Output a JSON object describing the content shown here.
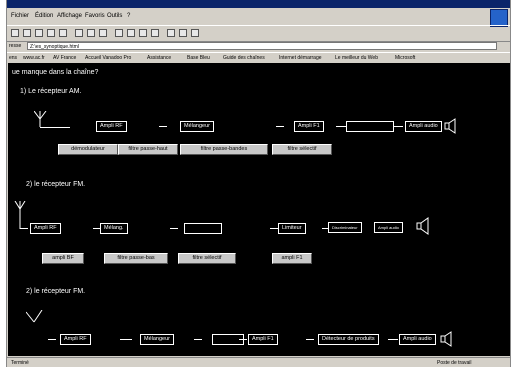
{
  "menu": {
    "fichier": "Fichier",
    "edition": "Édition",
    "affichage": "Affichage",
    "favoris": "Favoris",
    "outils": "Outils",
    "help": "?"
  },
  "address": {
    "label": "resse",
    "value": "Z:\\es_synoptique.html"
  },
  "links": {
    "label": "ens",
    "items": [
      "www.ac.fr",
      "AV France",
      "Accueil Vanadoo Pro",
      "Assistance",
      "Base Bleu",
      "Guide des chaînes",
      "Internet démarrage",
      "Le meilleur du Web",
      "Microsoft"
    ]
  },
  "page": {
    "question": "ue manque dans la chaîne?",
    "section1": {
      "title": "1) Le récepteur AM.",
      "blocks": [
        "Ampli RF",
        "Mélangeur",
        "Ampli F1",
        "Ampli audio"
      ],
      "buttons": [
        "démodulateur",
        "filtre passe-haut",
        "filtre passe-bandes",
        "filtre sélectif"
      ]
    },
    "section2": {
      "title": "2) le récepteur FM.",
      "blocks": [
        "Ampli RF",
        "Mélang.",
        "Limiteur",
        "Discriminateur",
        "Ampli audio"
      ],
      "buttons": [
        "ampli BF",
        "filtre passe-bas",
        "filtre sélectif",
        "ampli F1"
      ]
    },
    "section3": {
      "title": "2) le récepteur FM.",
      "blocks": [
        "Ampli RF",
        "Mélangeur",
        "Ampli F1",
        "Détecteur de produits",
        "Ampli audio"
      ]
    }
  },
  "status": {
    "left": "Terminé",
    "right": "Poste de travail"
  }
}
